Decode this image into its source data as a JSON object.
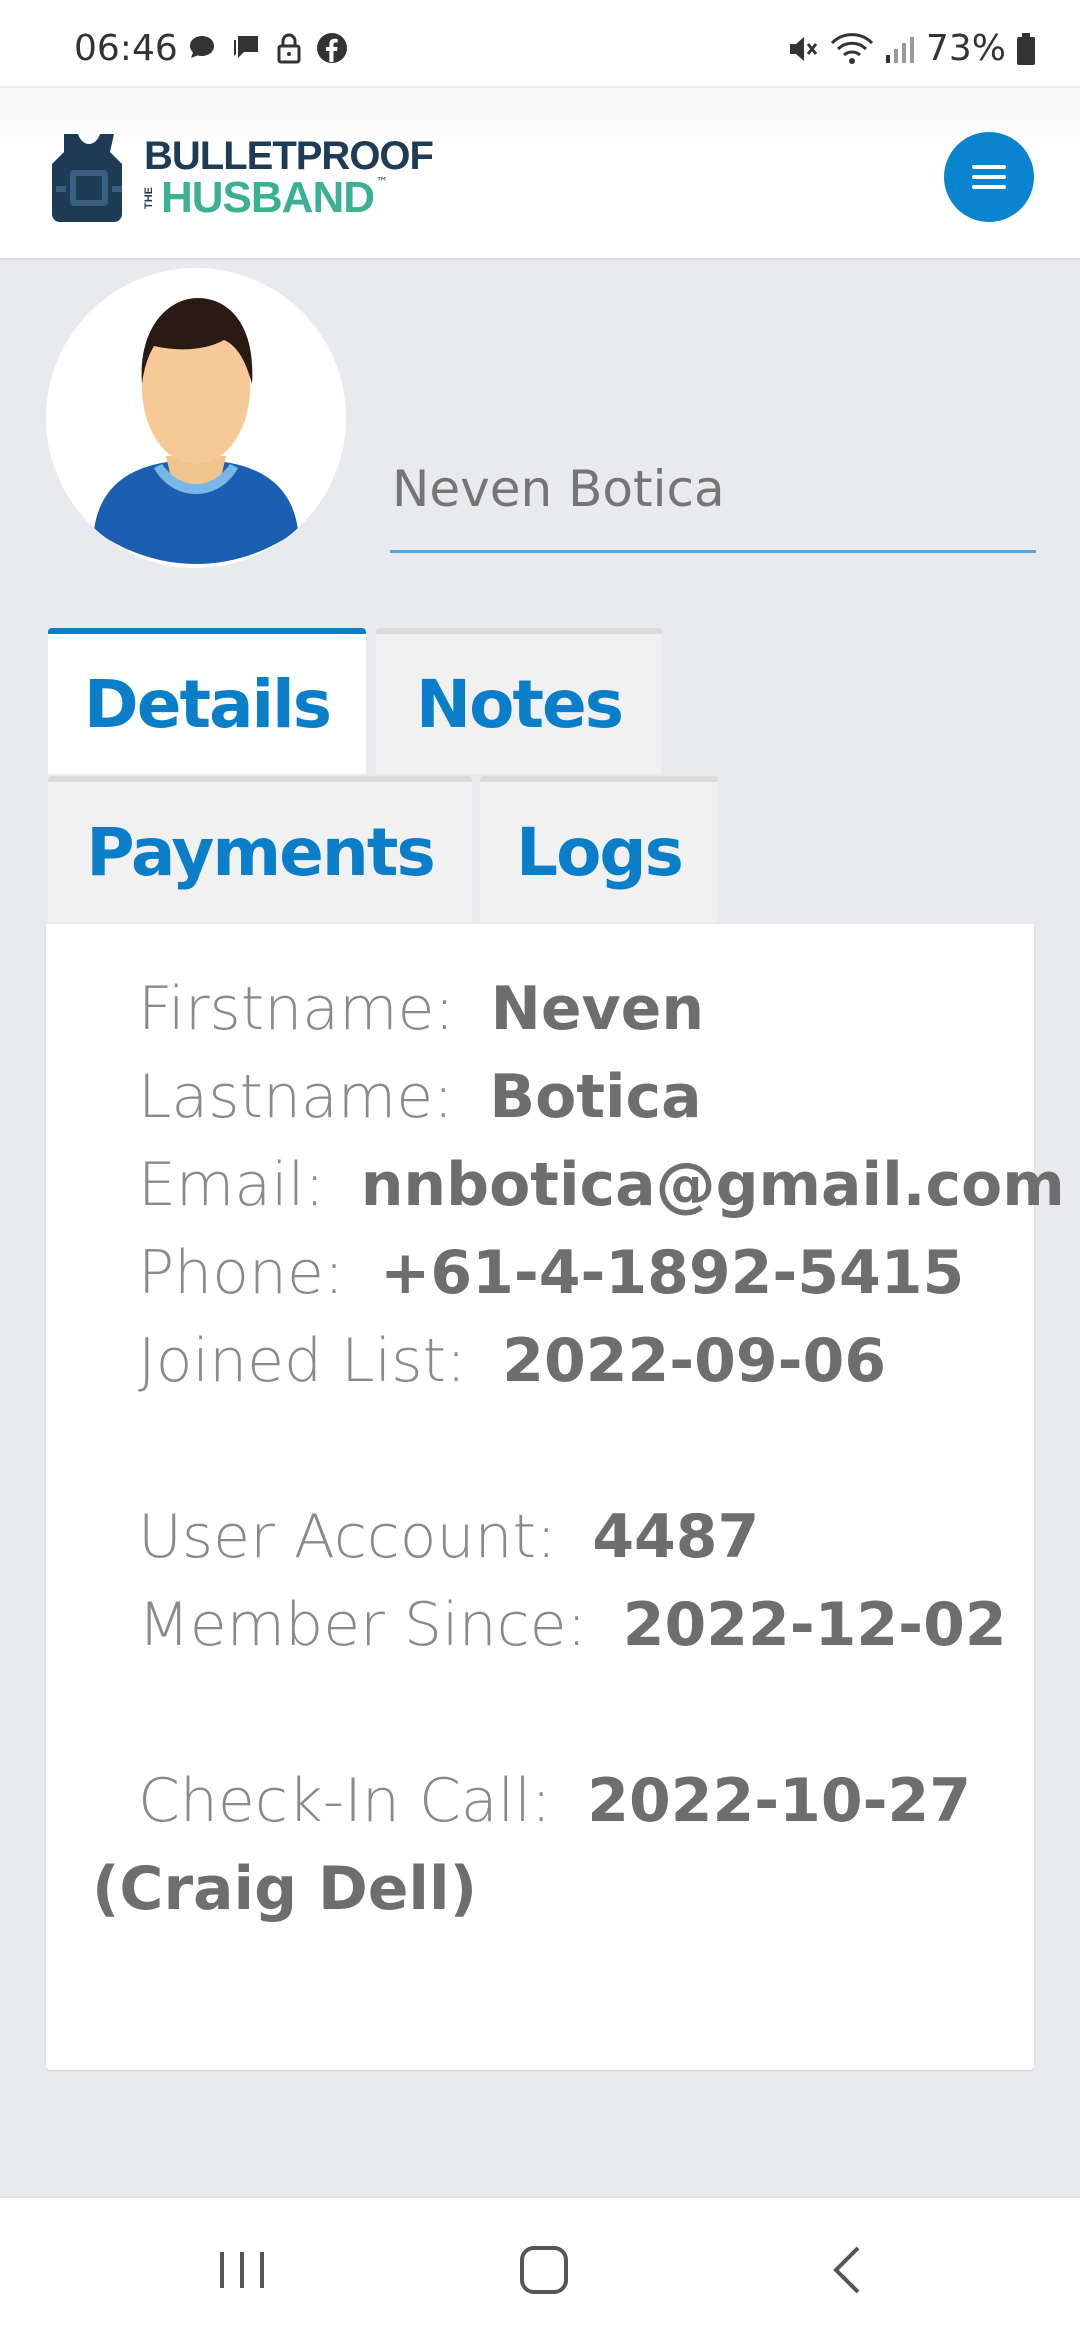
{
  "status_bar": {
    "time": "06:46",
    "battery": "73%",
    "left_icons": [
      "chat-bubble-icon",
      "message-icon",
      "lock-icon",
      "facebook-icon"
    ],
    "right_icons": [
      "mute-icon",
      "wifi-icon",
      "signal-icon",
      "battery-icon"
    ]
  },
  "header": {
    "logo": {
      "line1": "BULLETPROOF",
      "the": "THE",
      "line2": "HUSBAND",
      "tm": "™"
    },
    "menu_icon": "hamburger-icon"
  },
  "profile": {
    "name": "Neven Botica"
  },
  "tabs": [
    {
      "label": "Details",
      "active": true
    },
    {
      "label": "Notes",
      "active": false
    },
    {
      "label": "Payments",
      "active": false
    },
    {
      "label": "Logs",
      "active": false
    }
  ],
  "details": {
    "firstname": {
      "label": "Firstname:",
      "value": "Neven"
    },
    "lastname": {
      "label": "Lastname:",
      "value": "Botica"
    },
    "email": {
      "label": "Email:",
      "value": "nnbotica@gmail.com"
    },
    "phone": {
      "label": "Phone:",
      "value": "+61-4-1892-5415"
    },
    "joined": {
      "label": "Joined List:",
      "value": "2022-09-06"
    },
    "user_account": {
      "label": "User Account:",
      "value": "4487"
    },
    "member_since": {
      "label": "Member Since:",
      "value": "2022-12-02"
    },
    "checkin": {
      "label": "Check-In Call:",
      "value": "2022-10-27",
      "by": "(Craig Dell)"
    }
  },
  "colors": {
    "accent": "#0b84cf",
    "tab_text": "#0b7ec9",
    "logo_navy": "#1e3c55",
    "logo_green": "#3cb093",
    "background": "#e9eaed"
  },
  "nav_bar": [
    "recents-icon",
    "home-icon",
    "back-icon"
  ]
}
